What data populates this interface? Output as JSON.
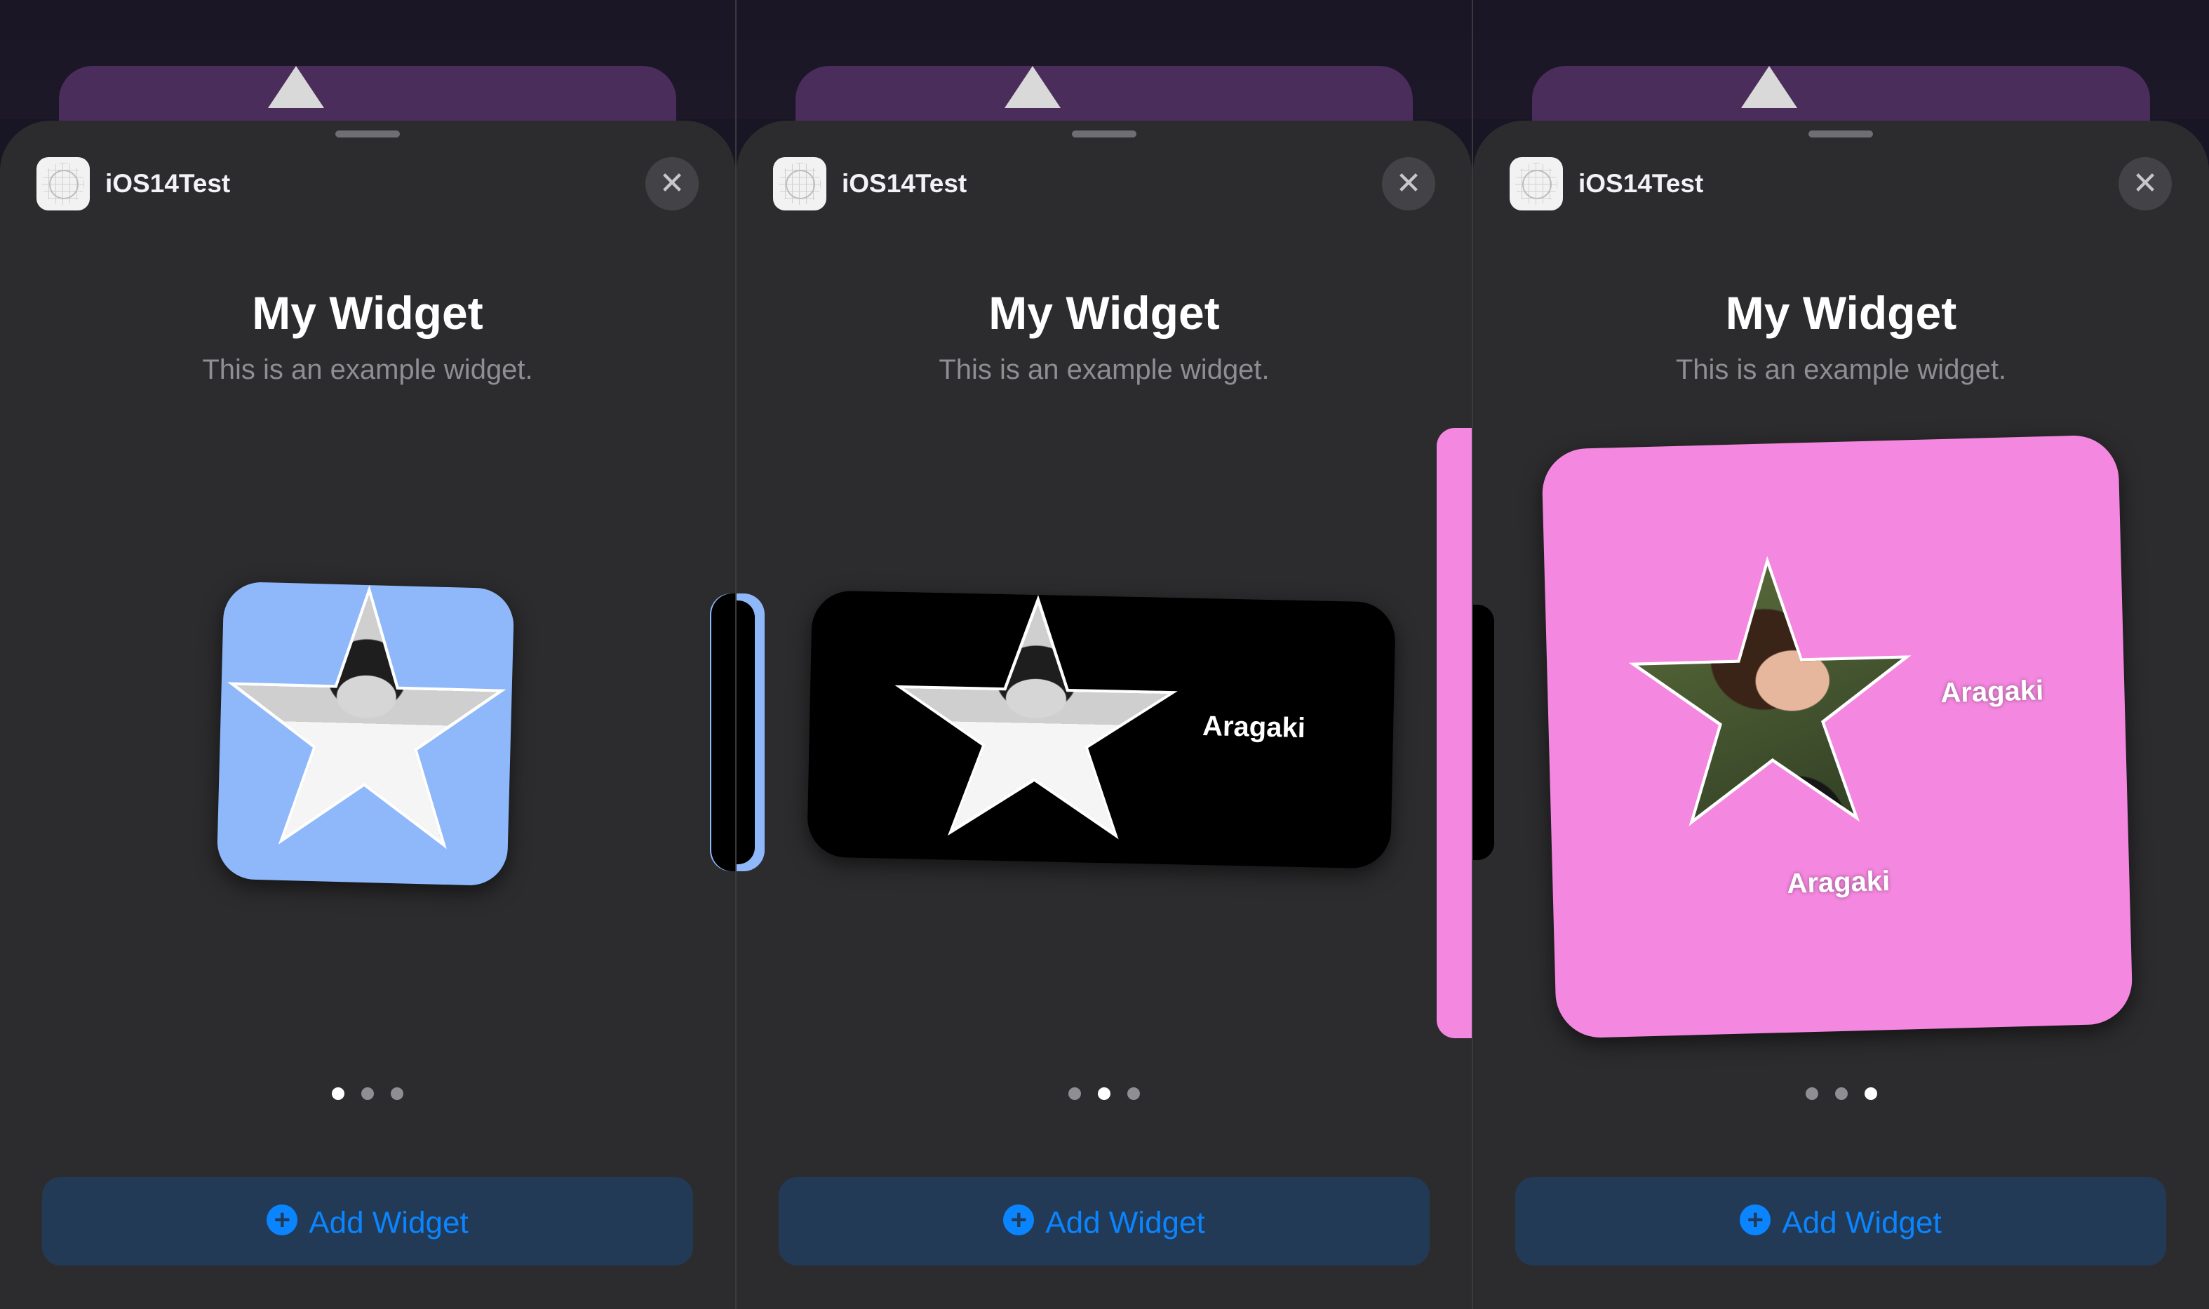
{
  "screens": [
    {
      "app_name": "iOS14Test",
      "title": "My Widget",
      "subtitle": "This is an example widget.",
      "widget_size": "small",
      "widget_bg": "#8fb8fb",
      "widget_labels": [],
      "page_indicator": {
        "count": 3,
        "active": 1
      },
      "add_button": "Add Widget"
    },
    {
      "app_name": "iOS14Test",
      "title": "My Widget",
      "subtitle": "This is an example widget.",
      "widget_size": "medium",
      "widget_bg": "#000000",
      "widget_labels": [
        "Aragaki"
      ],
      "page_indicator": {
        "count": 3,
        "active": 2
      },
      "add_button": "Add Widget"
    },
    {
      "app_name": "iOS14Test",
      "title": "My Widget",
      "subtitle": "This is an example widget.",
      "widget_size": "large",
      "widget_bg": "#f487df",
      "widget_labels": [
        "Aragaki",
        "Aragaki"
      ],
      "page_indicator": {
        "count": 3,
        "active": 3
      },
      "add_button": "Add Widget"
    }
  ],
  "icons": {
    "close": "close-icon",
    "add": "plus-circle-icon",
    "app": "app-icon"
  },
  "colors": {
    "sheet": "#2c2c2e",
    "add_button_bg": "#223a55",
    "accent": "#0a84ff",
    "pink": "#f487df",
    "blue": "#8fb8fb"
  }
}
